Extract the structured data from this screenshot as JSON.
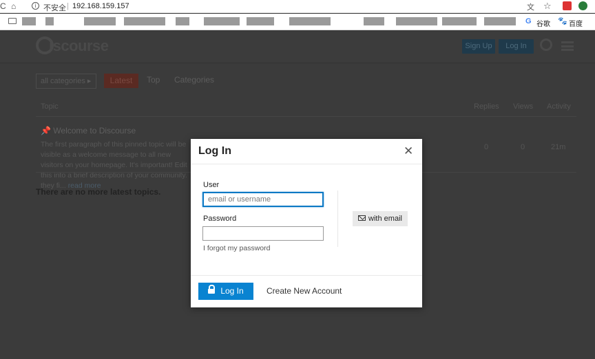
{
  "browser": {
    "security_label": "不安全",
    "separator": "|",
    "url": "192.168.159.157",
    "bookmarks": {
      "google_glyph": "G",
      "google_label": "谷歌",
      "baidu_glyph": "🐾",
      "baidu_label": "百度"
    }
  },
  "header": {
    "logo_text": "iscourse",
    "signup_label": "Sign Up",
    "login_label": "Log In"
  },
  "nav": {
    "category_dropdown": "all categories",
    "latest_label": "Latest",
    "top_label": "Top",
    "categories_label": "Categories"
  },
  "topic_table": {
    "headers": {
      "topic": "Topic",
      "replies": "Replies",
      "views": "Views",
      "activity": "Activity"
    },
    "rows": [
      {
        "title": "Welcome to Discourse",
        "excerpt": "The first paragraph of this pinned topic will be visible as a welcome message to all new visitors on your homepage. It's important! Edit this into a brief description of your community. they fi...",
        "read_more": "read more",
        "replies": "0",
        "views": "0",
        "activity": "21m"
      }
    ],
    "footer": "There are no more latest topics."
  },
  "modal": {
    "title": "Log In",
    "close_glyph": "✕",
    "user_label": "User",
    "user_placeholder": "email or username",
    "user_value": "",
    "password_label": "Password",
    "forgot_label": "I forgot my password",
    "email_login_label": "with email",
    "login_button": "Log In",
    "create_account": "Create New Account"
  },
  "colors": {
    "primary_blue": "#0983d1",
    "focus_blue": "#0b78c4",
    "overlay": "#3b3b3b"
  },
  "icons": [
    "reload-icon",
    "home-icon",
    "info-icon",
    "translate-icon",
    "star-icon",
    "folder-icon",
    "pin-icon",
    "search-icon",
    "hamburger-icon",
    "envelope-icon",
    "unlock-icon",
    "close-icon"
  ]
}
